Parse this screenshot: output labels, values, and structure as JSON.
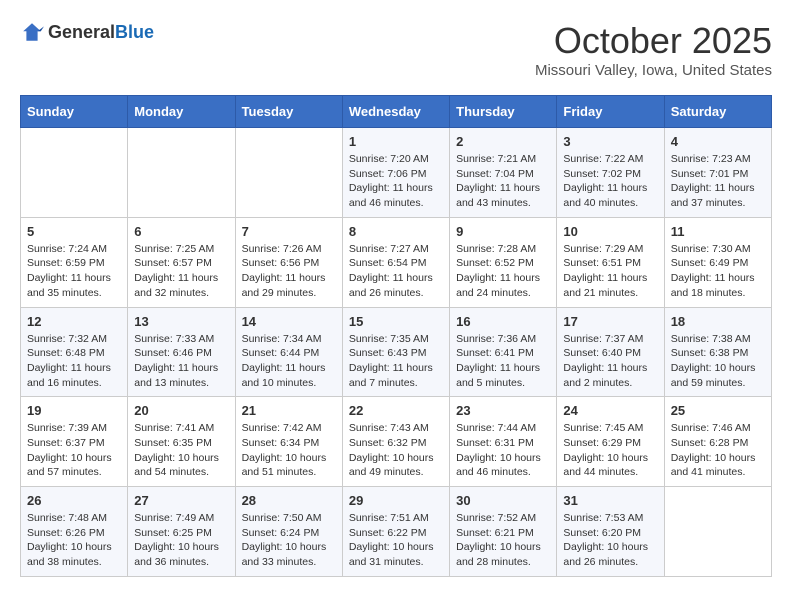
{
  "header": {
    "logo_general": "General",
    "logo_blue": "Blue",
    "month_title": "October 2025",
    "location": "Missouri Valley, Iowa, United States"
  },
  "weekdays": [
    "Sunday",
    "Monday",
    "Tuesday",
    "Wednesday",
    "Thursday",
    "Friday",
    "Saturday"
  ],
  "weeks": [
    [
      {
        "day": "",
        "info": ""
      },
      {
        "day": "",
        "info": ""
      },
      {
        "day": "",
        "info": ""
      },
      {
        "day": "1",
        "info": "Sunrise: 7:20 AM\nSunset: 7:06 PM\nDaylight: 11 hours and 46 minutes."
      },
      {
        "day": "2",
        "info": "Sunrise: 7:21 AM\nSunset: 7:04 PM\nDaylight: 11 hours and 43 minutes."
      },
      {
        "day": "3",
        "info": "Sunrise: 7:22 AM\nSunset: 7:02 PM\nDaylight: 11 hours and 40 minutes."
      },
      {
        "day": "4",
        "info": "Sunrise: 7:23 AM\nSunset: 7:01 PM\nDaylight: 11 hours and 37 minutes."
      }
    ],
    [
      {
        "day": "5",
        "info": "Sunrise: 7:24 AM\nSunset: 6:59 PM\nDaylight: 11 hours and 35 minutes."
      },
      {
        "day": "6",
        "info": "Sunrise: 7:25 AM\nSunset: 6:57 PM\nDaylight: 11 hours and 32 minutes."
      },
      {
        "day": "7",
        "info": "Sunrise: 7:26 AM\nSunset: 6:56 PM\nDaylight: 11 hours and 29 minutes."
      },
      {
        "day": "8",
        "info": "Sunrise: 7:27 AM\nSunset: 6:54 PM\nDaylight: 11 hours and 26 minutes."
      },
      {
        "day": "9",
        "info": "Sunrise: 7:28 AM\nSunset: 6:52 PM\nDaylight: 11 hours and 24 minutes."
      },
      {
        "day": "10",
        "info": "Sunrise: 7:29 AM\nSunset: 6:51 PM\nDaylight: 11 hours and 21 minutes."
      },
      {
        "day": "11",
        "info": "Sunrise: 7:30 AM\nSunset: 6:49 PM\nDaylight: 11 hours and 18 minutes."
      }
    ],
    [
      {
        "day": "12",
        "info": "Sunrise: 7:32 AM\nSunset: 6:48 PM\nDaylight: 11 hours and 16 minutes."
      },
      {
        "day": "13",
        "info": "Sunrise: 7:33 AM\nSunset: 6:46 PM\nDaylight: 11 hours and 13 minutes."
      },
      {
        "day": "14",
        "info": "Sunrise: 7:34 AM\nSunset: 6:44 PM\nDaylight: 11 hours and 10 minutes."
      },
      {
        "day": "15",
        "info": "Sunrise: 7:35 AM\nSunset: 6:43 PM\nDaylight: 11 hours and 7 minutes."
      },
      {
        "day": "16",
        "info": "Sunrise: 7:36 AM\nSunset: 6:41 PM\nDaylight: 11 hours and 5 minutes."
      },
      {
        "day": "17",
        "info": "Sunrise: 7:37 AM\nSunset: 6:40 PM\nDaylight: 11 hours and 2 minutes."
      },
      {
        "day": "18",
        "info": "Sunrise: 7:38 AM\nSunset: 6:38 PM\nDaylight: 10 hours and 59 minutes."
      }
    ],
    [
      {
        "day": "19",
        "info": "Sunrise: 7:39 AM\nSunset: 6:37 PM\nDaylight: 10 hours and 57 minutes."
      },
      {
        "day": "20",
        "info": "Sunrise: 7:41 AM\nSunset: 6:35 PM\nDaylight: 10 hours and 54 minutes."
      },
      {
        "day": "21",
        "info": "Sunrise: 7:42 AM\nSunset: 6:34 PM\nDaylight: 10 hours and 51 minutes."
      },
      {
        "day": "22",
        "info": "Sunrise: 7:43 AM\nSunset: 6:32 PM\nDaylight: 10 hours and 49 minutes."
      },
      {
        "day": "23",
        "info": "Sunrise: 7:44 AM\nSunset: 6:31 PM\nDaylight: 10 hours and 46 minutes."
      },
      {
        "day": "24",
        "info": "Sunrise: 7:45 AM\nSunset: 6:29 PM\nDaylight: 10 hours and 44 minutes."
      },
      {
        "day": "25",
        "info": "Sunrise: 7:46 AM\nSunset: 6:28 PM\nDaylight: 10 hours and 41 minutes."
      }
    ],
    [
      {
        "day": "26",
        "info": "Sunrise: 7:48 AM\nSunset: 6:26 PM\nDaylight: 10 hours and 38 minutes."
      },
      {
        "day": "27",
        "info": "Sunrise: 7:49 AM\nSunset: 6:25 PM\nDaylight: 10 hours and 36 minutes."
      },
      {
        "day": "28",
        "info": "Sunrise: 7:50 AM\nSunset: 6:24 PM\nDaylight: 10 hours and 33 minutes."
      },
      {
        "day": "29",
        "info": "Sunrise: 7:51 AM\nSunset: 6:22 PM\nDaylight: 10 hours and 31 minutes."
      },
      {
        "day": "30",
        "info": "Sunrise: 7:52 AM\nSunset: 6:21 PM\nDaylight: 10 hours and 28 minutes."
      },
      {
        "day": "31",
        "info": "Sunrise: 7:53 AM\nSunset: 6:20 PM\nDaylight: 10 hours and 26 minutes."
      },
      {
        "day": "",
        "info": ""
      }
    ]
  ]
}
